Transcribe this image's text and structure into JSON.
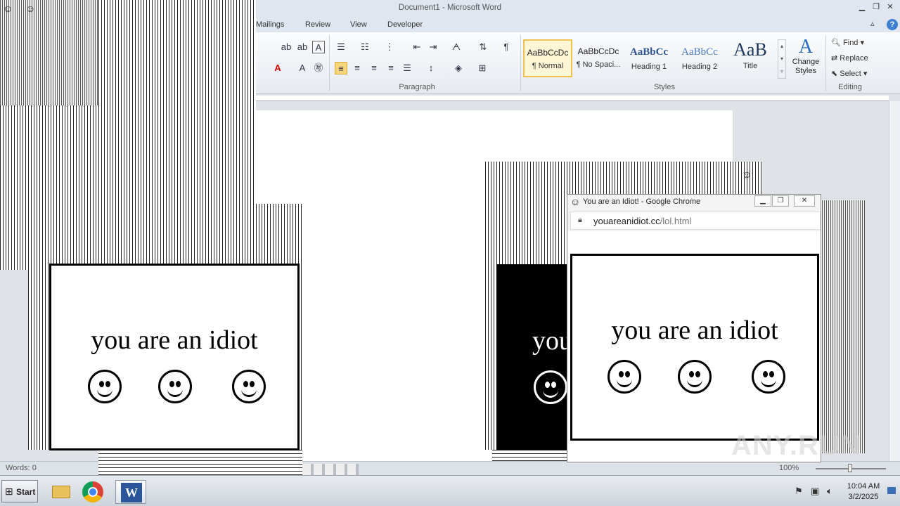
{
  "word": {
    "title": "Document1 - Microsoft Word",
    "tabs": [
      "Mailings",
      "Review",
      "View",
      "Developer"
    ],
    "groups": {
      "paragraph": "Paragraph",
      "styles": "Styles",
      "editing": "Editing"
    },
    "styles": [
      {
        "preview": "AaBbCcDc",
        "name": "¶ Normal"
      },
      {
        "preview": "AaBbCcDc",
        "name": "¶ No Spaci..."
      },
      {
        "preview": "AaBbCc",
        "name": "Heading 1"
      },
      {
        "preview": "AaBbCc",
        "name": "Heading 2"
      },
      {
        "preview": "AaB",
        "name": "Title"
      }
    ],
    "change_styles": "Change Styles",
    "editing": {
      "find": "Find",
      "replace": "Replace",
      "select": "Select"
    },
    "status": {
      "words": "Words: 0",
      "zoom": "100%"
    }
  },
  "idiot": {
    "text": "you are an idiot",
    "black_text": "you"
  },
  "chrome": {
    "title": "You are an Idiot! - Google Chrome",
    "url_domain": "youareanidiot.cc",
    "url_path": "/lol.html"
  },
  "taskbar": {
    "start": "Start",
    "time": "10:04 AM",
    "date": "3/2/2025"
  },
  "watermark": "ANY.RUN",
  "colors": {
    "word_blue": "#2b579a",
    "style_selected": "#f0c14b"
  },
  "icons": [
    "smiley-icon",
    "lock-icon",
    "folder-icon",
    "chrome-icon",
    "word-icon",
    "flag-icon",
    "speaker-icon",
    "network-icon",
    "windows-flag-icon",
    "help-icon"
  ]
}
